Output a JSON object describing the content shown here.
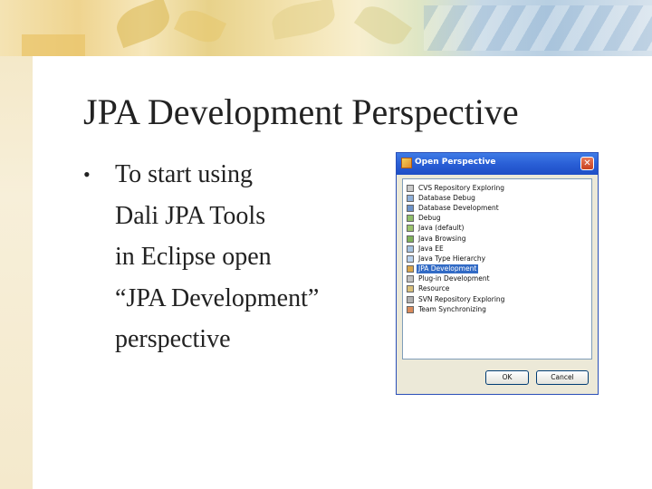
{
  "slide": {
    "title": "JPA Development Perspective",
    "bullet_symbol": "•",
    "bullet_lines": [
      "To start using",
      "Dali JPA Tools",
      "in Eclipse open",
      "“JPA Development”",
      "perspective"
    ]
  },
  "dialog": {
    "title": "Open Perspective",
    "close_glyph": "✕",
    "items": [
      {
        "label": "CVS Repository Exploring",
        "icon": "cvs-icon",
        "color": "#c9c9c9"
      },
      {
        "label": "Database Debug",
        "icon": "database-debug-icon",
        "color": "#8fb0d9"
      },
      {
        "label": "Database Development",
        "icon": "database-icon",
        "color": "#6d93c9"
      },
      {
        "label": "Debug",
        "icon": "bug-icon",
        "color": "#8fbf6a"
      },
      {
        "label": "Java (default)",
        "icon": "java-icon",
        "color": "#9bc46d"
      },
      {
        "label": "Java Browsing",
        "icon": "java-browsing-icon",
        "color": "#7fb35a"
      },
      {
        "label": "Java EE",
        "icon": "java-ee-icon",
        "color": "#a4c2e0"
      },
      {
        "label": "Java Type Hierarchy",
        "icon": "hierarchy-icon",
        "color": "#b9d2ee"
      },
      {
        "label": "JPA Development",
        "icon": "jpa-icon",
        "color": "#d9a54a"
      },
      {
        "label": "Plug-in Development",
        "icon": "plugin-icon",
        "color": "#c0c0c0"
      },
      {
        "label": "Resource",
        "icon": "resource-icon",
        "color": "#d9c07a"
      },
      {
        "label": "SVN Repository Exploring",
        "icon": "svn-icon",
        "color": "#b0b0b0"
      },
      {
        "label": "Team Synchronizing",
        "icon": "sync-icon",
        "color": "#d98a5a"
      }
    ],
    "selected_index": 8,
    "ok_label": "OK",
    "cancel_label": "Cancel",
    "accent_color": "#316ac5"
  }
}
